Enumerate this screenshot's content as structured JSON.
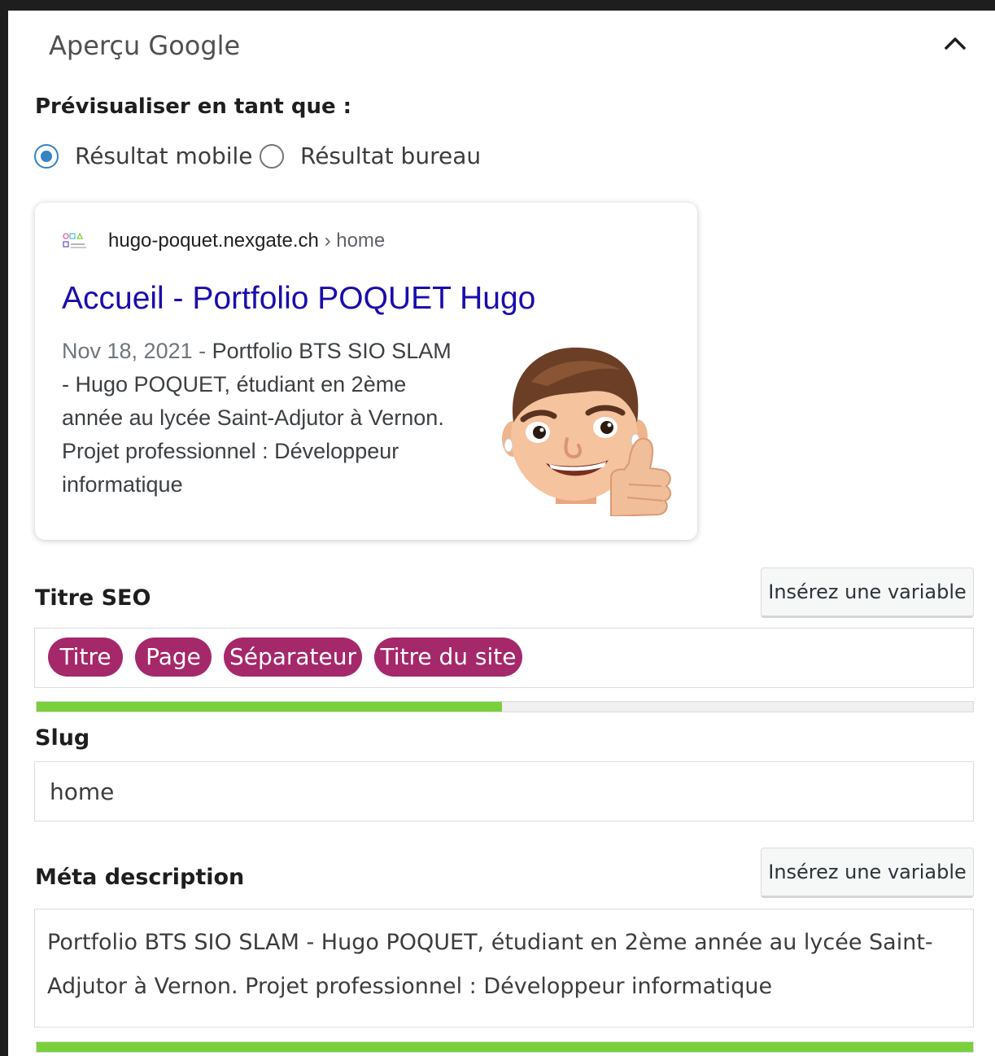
{
  "header": {
    "title": "Aperçu Google",
    "collapse_icon": "chevron-up-icon"
  },
  "preview": {
    "label": "Prévisualiser en tant que :",
    "options": [
      {
        "label": "Résultat mobile",
        "checked": true
      },
      {
        "label": "Résultat bureau",
        "checked": false
      }
    ]
  },
  "google_result": {
    "favicon_icon": "site-logo-icon",
    "url": "hugo-poquet.nexgate.ch",
    "breadcrumb": "› home",
    "title": "Accueil - Portfolio POQUET Hugo",
    "date": "Nov 18, 2021",
    "date_separator": " - ",
    "description": "Portfolio BTS SIO SLAM - Hugo POQUET, étudiant en 2ème année au lycée Saint-Adjutor à Vernon. Projet professionnel : Développeur informatique",
    "thumbnail": "memoji-thumbs-up-image"
  },
  "seo_title": {
    "label": "Titre SEO",
    "insert_variable_label": "Insérez une variable",
    "variables": [
      "Titre",
      "Page",
      "Séparateur",
      "Titre du site"
    ],
    "progress_fraction": 0.497,
    "progress_color": "#7ad03a"
  },
  "slug": {
    "label": "Slug",
    "value": "home"
  },
  "meta_description": {
    "label": "Méta description",
    "insert_variable_label": "Insérez une variable",
    "value": "Portfolio BTS SIO SLAM - Hugo POQUET, étudiant en 2ème année au lycée Saint-Adjutor à Vernon. Projet professionnel : Développeur informatique",
    "progress_fraction": 1.0,
    "progress_color": "#7ad03a"
  },
  "colors": {
    "accent_radio": "#3582c4",
    "variable_pill": "#a4286a",
    "result_title_link": "#1a0dab"
  }
}
